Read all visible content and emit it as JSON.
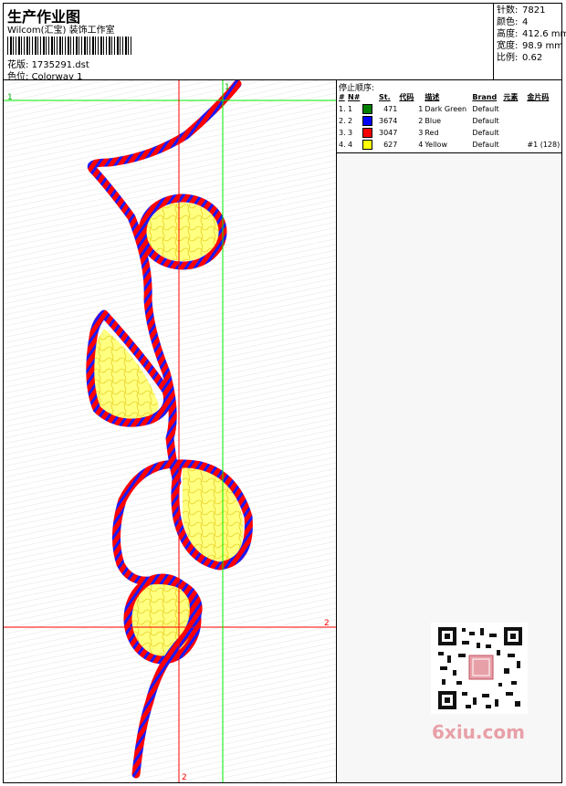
{
  "header": {
    "title": "生产作业图",
    "subtitle": "Wilcom(汇宝) 装饰工作室",
    "design_label": "花版:",
    "design_value": "1735291.dst",
    "colorway_label": "色位:",
    "colorway_value": "Colorway 1"
  },
  "stats": [
    {
      "label": "针数:",
      "value": "7821"
    },
    {
      "label": "颜色:",
      "value": "4"
    },
    {
      "label": "高度:",
      "value": "412.6 mm"
    },
    {
      "label": "宽度:",
      "value": "98.9 mm"
    },
    {
      "label": "比例:",
      "value": "0.62"
    }
  ],
  "stop_sequence": {
    "title": "停止顺序:",
    "columns": [
      "#",
      "N#",
      "St.",
      "代码",
      "描述",
      "Brand",
      "元素",
      "金片码"
    ],
    "rows": [
      {
        "num": "1.",
        "n": "1",
        "color": "#008000",
        "st": "471",
        "code": "1",
        "desc": "Dark Green",
        "brand": "Default",
        "element": "",
        "sequin": ""
      },
      {
        "num": "2.",
        "n": "2",
        "color": "#0000ff",
        "st": "3674",
        "code": "2",
        "desc": "Blue",
        "brand": "Default",
        "element": "",
        "sequin": ""
      },
      {
        "num": "3.",
        "n": "3",
        "color": "#ff0000",
        "st": "3047",
        "code": "3",
        "desc": "Red",
        "brand": "Default",
        "element": "",
        "sequin": ""
      },
      {
        "num": "4.",
        "n": "4",
        "color": "#ffff00",
        "st": "627",
        "code": "4",
        "desc": "Yellow",
        "brand": "Default",
        "element": "",
        "sequin": "#1 (128)"
      }
    ]
  },
  "guides": {
    "h1": "1",
    "h2": "2",
    "v1": "1",
    "v2": "2"
  },
  "watermark": {
    "text": "6xiu.com"
  },
  "colors": {
    "stitch_red": "#ff0000",
    "stitch_blue": "#1a1aff",
    "fill_yellow": "#ffff80",
    "guide_red": "#ff0000",
    "guide_green": "#00ee00"
  },
  "icons": {
    "barcode": "barcode-icon",
    "qr": "qr-code-icon"
  }
}
